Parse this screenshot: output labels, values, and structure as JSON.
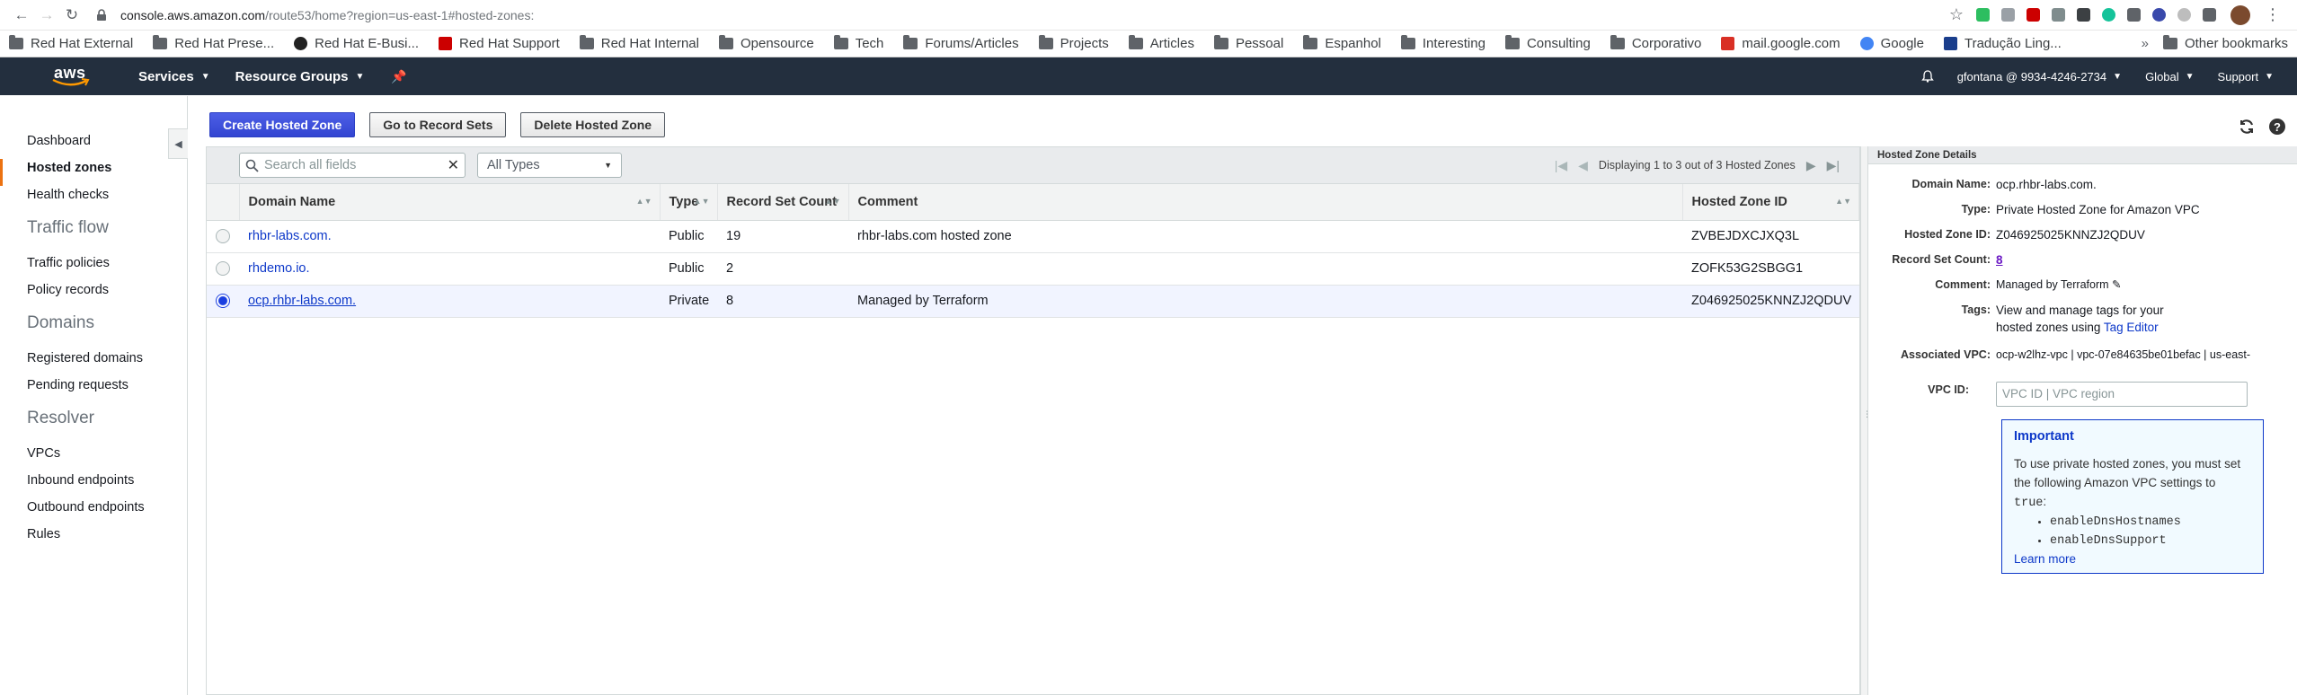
{
  "browser": {
    "url_host": "console.aws.amazon.com",
    "url_path": "/route53/home?region=us-east-1#hosted-zones:",
    "bookmarks": [
      {
        "label": "Red Hat External",
        "icon": "folder"
      },
      {
        "label": "Red Hat Prese...",
        "icon": "folder"
      },
      {
        "label": "Red Hat E-Busi...",
        "icon": "redhat"
      },
      {
        "label": "Red Hat Support",
        "icon": "redhat-support"
      },
      {
        "label": "Red Hat Internal",
        "icon": "folder"
      },
      {
        "label": "Opensource",
        "icon": "folder"
      },
      {
        "label": "Tech",
        "icon": "folder"
      },
      {
        "label": "Forums/Articles",
        "icon": "folder"
      },
      {
        "label": "Projects",
        "icon": "folder"
      },
      {
        "label": "Articles",
        "icon": "folder"
      },
      {
        "label": "Pessoal",
        "icon": "folder"
      },
      {
        "label": "Espanhol",
        "icon": "folder"
      },
      {
        "label": "Interesting",
        "icon": "folder"
      },
      {
        "label": "Consulting",
        "icon": "folder"
      },
      {
        "label": "Corporativo",
        "icon": "folder"
      },
      {
        "label": "mail.google.com",
        "icon": "gmail"
      },
      {
        "label": "Google",
        "icon": "google"
      },
      {
        "label": "Tradução Ling...",
        "icon": "translate"
      }
    ],
    "other_bookmarks": "Other bookmarks"
  },
  "aws_nav": {
    "logo": "aws",
    "services": "Services",
    "resource_groups": "Resource Groups",
    "account": "gfontana @ 9934-4246-2734",
    "region": "Global",
    "support": "Support"
  },
  "sidebar": {
    "items_top": [
      "Dashboard",
      "Hosted zones",
      "Health checks"
    ],
    "traffic_flow": {
      "title": "Traffic flow",
      "items": [
        "Traffic policies",
        "Policy records"
      ]
    },
    "domains": {
      "title": "Domains",
      "items": [
        "Registered domains",
        "Pending requests"
      ]
    },
    "resolver": {
      "title": "Resolver",
      "items": [
        "VPCs",
        "Inbound endpoints",
        "Outbound endpoints",
        "Rules"
      ]
    }
  },
  "toolbar": {
    "create": "Create Hosted Zone",
    "goto": "Go to Record Sets",
    "delete": "Delete Hosted Zone"
  },
  "filter": {
    "search_placeholder": "Search all fields",
    "type_selected": "All Types",
    "pager_text": "Displaying 1 to 3 out of 3 Hosted Zones"
  },
  "table": {
    "columns": [
      "Domain Name",
      "Type",
      "Record Set Count",
      "Comment",
      "Hosted Zone ID"
    ],
    "rows": [
      {
        "domain": "rhbr-labs.com.",
        "type": "Public",
        "count": "19",
        "comment": "rhbr-labs.com hosted zone",
        "id": "ZVBEJDXCJXQ3L"
      },
      {
        "domain": "rhdemo.io.",
        "type": "Public",
        "count": "2",
        "comment": "",
        "id": "ZOFK53G2SBGG1"
      },
      {
        "domain": "ocp.rhbr-labs.com.",
        "type": "Private",
        "count": "8",
        "comment": "Managed by Terraform",
        "id": "Z046925025KNNZJ2QDUV"
      }
    ]
  },
  "details": {
    "title": "Hosted Zone Details",
    "domain_name_label": "Domain Name:",
    "domain_name": "ocp.rhbr-labs.com.",
    "type_label": "Type:",
    "type": "Private Hosted Zone for Amazon VPC",
    "zone_id_label": "Hosted Zone ID:",
    "zone_id": "Z046925025KNNZJ2QDUV",
    "count_label": "Record Set Count:",
    "count": "8",
    "comment_label": "Comment:",
    "comment": "Managed by Terraform",
    "tags_label": "Tags:",
    "tags_text": "View and manage tags for your hosted zones using",
    "tags_link": "Tag Editor",
    "vpc_label": "Associated VPC:",
    "vpc": "ocp-w2lhz-vpc | vpc-07e84635be01befac | us-east-",
    "vpc_id_label": "VPC ID:",
    "vpc_id_placeholder": "VPC ID | VPC region",
    "important": {
      "title": "Important",
      "text1": "To use private hosted zones, you must set the following Amazon VPC settings to",
      "code_true": "true",
      "text2": ":",
      "settings": [
        "enableDnsHostnames",
        "enableDnsSupport"
      ],
      "learn_more": "Learn more"
    }
  }
}
